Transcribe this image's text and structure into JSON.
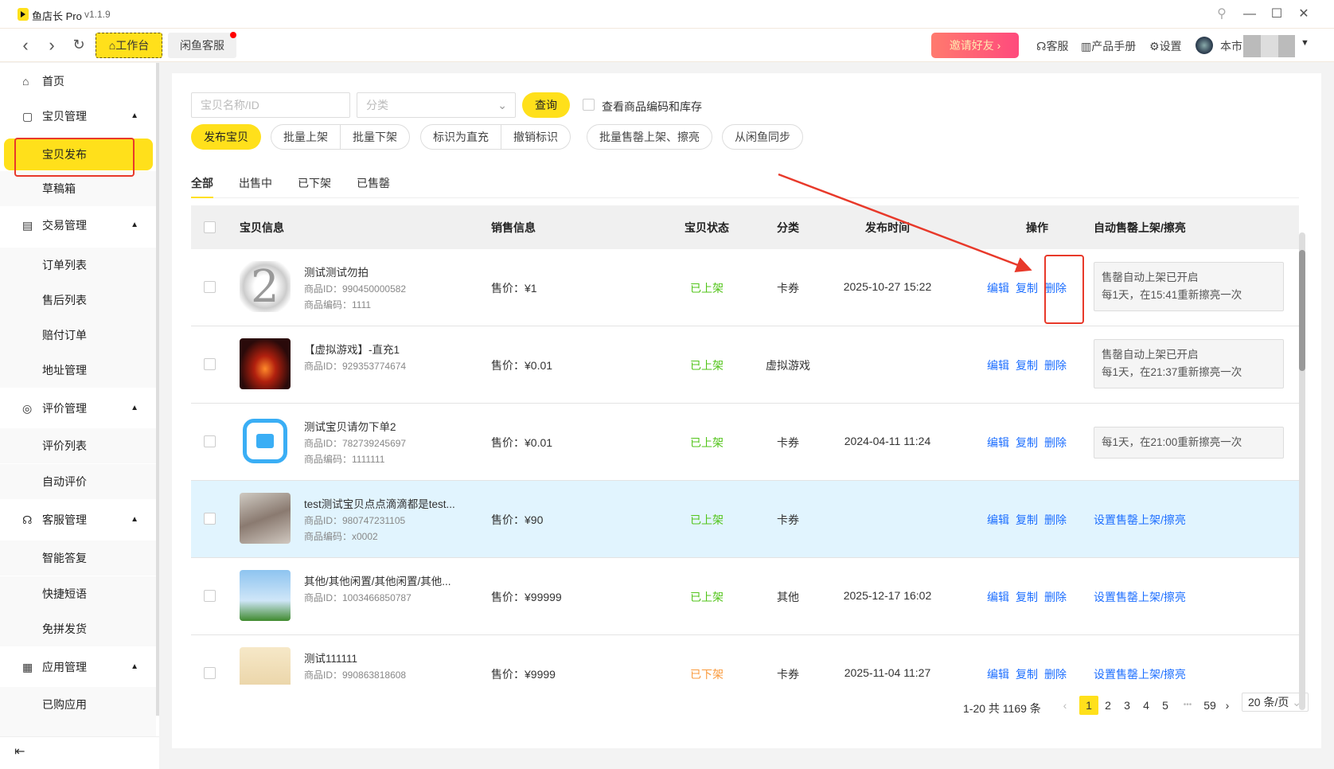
{
  "app": {
    "name": "鱼店长 Pro",
    "version": "v1.1.9"
  },
  "window": {
    "pin": "⚲",
    "minimize": "—",
    "maximize": "☐",
    "close": "✕"
  },
  "nav": {
    "back": "‹",
    "forward": "›",
    "refresh": "↻",
    "tabs": [
      {
        "label": "工作台",
        "icon": "home-icon"
      },
      {
        "label": "闲鱼客服",
        "badge": true
      }
    ]
  },
  "header": {
    "invite": "邀请好友",
    "service": "客服",
    "manual": "产品手册",
    "settings": "设置",
    "user": "本市"
  },
  "sidebar": {
    "items": [
      {
        "label": "首页",
        "icon": "⌂",
        "type": "top"
      },
      {
        "label": "宝贝管理",
        "icon": "▢",
        "type": "group"
      },
      {
        "label": "宝贝发布",
        "type": "sub",
        "active": true
      },
      {
        "label": "草稿箱",
        "type": "sub"
      },
      {
        "label": "交易管理",
        "icon": "▤",
        "type": "group"
      },
      {
        "label": "订单列表",
        "type": "sub"
      },
      {
        "label": "售后列表",
        "type": "sub"
      },
      {
        "label": "赔付订单",
        "type": "sub"
      },
      {
        "label": "地址管理",
        "type": "sub"
      },
      {
        "label": "评价管理",
        "icon": "◎",
        "type": "group"
      },
      {
        "label": "评价列表",
        "type": "sub"
      },
      {
        "label": "自动评价",
        "type": "sub"
      },
      {
        "label": "客服管理",
        "icon": "☊",
        "type": "group"
      },
      {
        "label": "智能答复",
        "type": "sub"
      },
      {
        "label": "快捷短语",
        "type": "sub"
      },
      {
        "label": "免拼发货",
        "type": "sub"
      },
      {
        "label": "应用管理",
        "icon": "▦",
        "type": "group"
      },
      {
        "label": "已购应用",
        "type": "sub"
      }
    ]
  },
  "filters": {
    "name_placeholder": "宝贝名称/ID",
    "category_placeholder": "分类",
    "query": "查询",
    "show_code_stock": "查看商品编码和库存"
  },
  "actions": {
    "publish": "发布宝贝",
    "batch_on": "批量上架",
    "batch_off": "批量下架",
    "mark_direct": "标识为直充",
    "unmark": "撤销标识",
    "batch_soldout": "批量售罄上架、擦亮",
    "sync": "从闲鱼同步"
  },
  "tabs": [
    "全部",
    "出售中",
    "已下架",
    "已售罄"
  ],
  "table": {
    "headers": {
      "info": "宝贝信息",
      "sales": "销售信息",
      "status": "宝贝状态",
      "category": "分类",
      "time": "发布时间",
      "ops": "操作",
      "auto": "自动售罄上架/擦亮"
    },
    "op_labels": [
      "编辑",
      "复制",
      "删除"
    ],
    "rows": [
      {
        "name": "测试测试勿拍",
        "id": "商品ID：990450000582",
        "code": "商品编码：1111",
        "price": "售价：¥1",
        "status": "已上架",
        "category": "卡券",
        "time": "2025-10-27 15:22",
        "auto": [
          "售罄自动上架已开启",
          "每1天，在15:41重新擦亮一次"
        ]
      },
      {
        "name": "【虚拟游戏】-直充1",
        "id": "商品ID：929353774674",
        "code": "",
        "price": "售价：¥0.01",
        "status": "已上架",
        "category": "虚拟游戏",
        "time": "",
        "auto": [
          "售罄自动上架已开启",
          "每1天，在21:37重新擦亮一次"
        ]
      },
      {
        "name": "测试宝贝请勿下单2",
        "id": "商品ID：782739245697",
        "code": "商品编码：1111111",
        "price": "售价：¥0.01",
        "status": "已上架",
        "category": "卡券",
        "time": "2024-04-11 11:24",
        "auto": [
          "每1天，在21:00重新擦亮一次"
        ]
      },
      {
        "name": "test测试宝贝点点滴滴都是test...",
        "id": "商品ID：980747231105",
        "code": "商品编码：x0002",
        "price": "售价：¥90",
        "status": "已上架",
        "category": "卡券",
        "time": "",
        "auto_link": "设置售罄上架/擦亮",
        "highlight": true
      },
      {
        "name": "其他/其他闲置/其他闲置/其他...",
        "id": "商品ID：1003466850787",
        "code": "",
        "price": "售价：¥99999",
        "status": "已上架",
        "category": "其他",
        "time": "2025-12-17 16:02",
        "auto_link": "设置售罄上架/擦亮"
      },
      {
        "name": "测试111111",
        "id": "商品ID：990863818608",
        "code": "",
        "price": "售价：¥9999",
        "status": "已下架",
        "category": "卡券",
        "time": "2025-11-04 11:27",
        "auto_link": "设置售罄上架/擦亮"
      }
    ]
  },
  "pagination": {
    "summary": "1-20 共 1169 条",
    "pages": [
      "1",
      "2",
      "3",
      "4",
      "5",
      "•••",
      "59"
    ],
    "current": "1",
    "page_size": "20 条/页"
  },
  "colors": {
    "accent": "#ffe01b",
    "link": "#1e6fff",
    "on_shelf": "#52c41a",
    "off_shelf": "#fa9a3c",
    "annotation": "#e8392a"
  }
}
